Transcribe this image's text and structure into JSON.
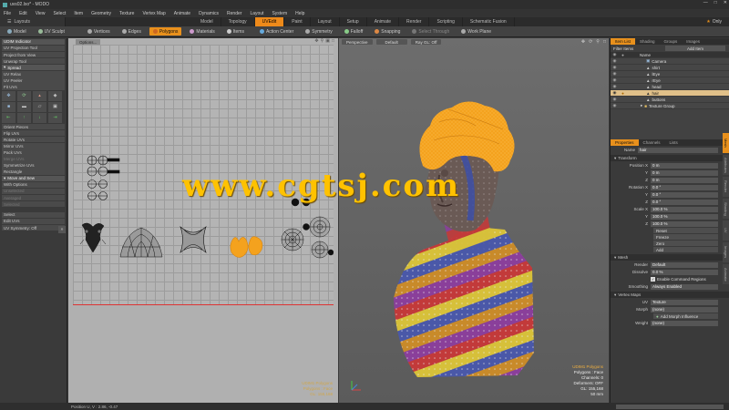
{
  "window": {
    "title": "uvs02.lxo* - MODO"
  },
  "menu": [
    "File",
    "Edit",
    "View",
    "Select",
    "Item",
    "Geometry",
    "Texture",
    "Vertex Map",
    "Animate",
    "Dynamics",
    "Render",
    "Layout",
    "System",
    "Help"
  ],
  "layouts": {
    "label": "Layouts",
    "tabs": [
      "Model",
      "Topology",
      "UVEdit",
      "Paint",
      "Layout",
      "Setup",
      "Animate",
      "Render",
      "Scripting",
      "Schematic Fusion"
    ],
    "active": "UVEdit",
    "only_label": "Only"
  },
  "toolbar": {
    "items": [
      "Model",
      "UV Sculpt",
      "Vertices",
      "Edges",
      "Polygons",
      "Materials",
      "Items",
      "Action Center",
      "Symmetry",
      "Falloff",
      "Snapping",
      "Select Through",
      "Work Plane"
    ],
    "active": "Polygons"
  },
  "left_panel": {
    "groups1": [
      "UDIM Indicator",
      "UV Projection Tool",
      "Project from View",
      "Unwrap Tool"
    ],
    "spread_header": "Spread",
    "groups2": [
      "UV Relax",
      "UV Peeler",
      "Fit UVs"
    ],
    "groups3": [
      "Orient Pieces",
      "Flip UVs",
      "Rotate UVs",
      "Mirror UVs",
      "Pack UVs",
      "Merge UVs",
      "Symmetrize UVs",
      "Rectangle"
    ],
    "move_sew_header": "Move and Sew",
    "groups4": [
      "With Options",
      "Unselected",
      "Averaged",
      "Selected"
    ],
    "groups5": [
      "Select",
      "Edit UVs",
      "UV Symmetry: Off"
    ]
  },
  "uv_view": {
    "options_label": "Options...",
    "info_line1": "UDIM1 Polygons",
    "info_line2": "Polygons : Face",
    "info_line3": "GL: 155,168",
    "status": "Position U, V :   2.86, -0.47"
  },
  "viewport": {
    "buttons": [
      "Perspective",
      "Default",
      "Ray GL: Off"
    ],
    "info": [
      "UDIM1 Polygons",
      "Polygons : Face",
      "Channels: 0",
      "Deformers: OFF",
      "GL: 155,168",
      "50 mm"
    ]
  },
  "watermark": "www.cgtsj.com",
  "right_panel": {
    "tabs": [
      "Item List",
      "Shading",
      "Groups",
      "Images"
    ],
    "active_tab": "Item List",
    "filter_label": "Filter Items",
    "add_item_label": "Add Item",
    "name_header": "Name",
    "items": [
      "Camera",
      "shirt",
      "lEye",
      "rEye",
      "head",
      "hair",
      "buttons",
      "Texture Group"
    ],
    "selected_item": "hair",
    "prop_tabs": [
      "Properties",
      "Channels",
      "Lists"
    ],
    "active_prop_tab": "Properties",
    "name_label": "Name",
    "name_value": "hair",
    "transform": {
      "header": "Transform",
      "position": [
        {
          "label": "Position X",
          "value": "0 m"
        },
        {
          "label": "Y",
          "value": "0 m"
        },
        {
          "label": "Z",
          "value": "0 m"
        }
      ],
      "rotation": [
        {
          "label": "Rotation X",
          "value": "0.0 °"
        },
        {
          "label": "Y",
          "value": "0.0 °"
        },
        {
          "label": "Z",
          "value": "0.0 °"
        }
      ],
      "scale": [
        {
          "label": "Scale X",
          "value": "100.0 %"
        },
        {
          "label": "Y",
          "value": "100.0 %"
        },
        {
          "label": "Z",
          "value": "100.0 %"
        }
      ],
      "buttons": [
        "Reset",
        "Freeze",
        "Zero",
        "Add"
      ]
    },
    "mesh": {
      "header": "Mesh",
      "render_label": "Render",
      "render_value": "Default",
      "dissolve_label": "Dissolve",
      "dissolve_value": "0.0 %",
      "command_regions": "Enable Command Regions",
      "smoothing_label": "Smoothing",
      "smoothing_value": "Always Enabled"
    },
    "vertex_maps": {
      "header": "Vertex Maps",
      "uv_label": "UV",
      "uv_value": "Texture",
      "morph_label": "Morph",
      "morph_value": "(none)",
      "add_morph": "Add Morph Influence",
      "weight_label": "Weight",
      "weight_value": "(none)"
    },
    "side_tabs": [
      "Mesh",
      "Attributes",
      "Render",
      "Shading",
      "UV",
      "Images",
      "Animate"
    ]
  },
  "colors": {
    "accent": "#ee8a1a",
    "selected_row": "#e0c089",
    "uv_bg": "#b4b4b4",
    "hair": "#f4a21e"
  }
}
